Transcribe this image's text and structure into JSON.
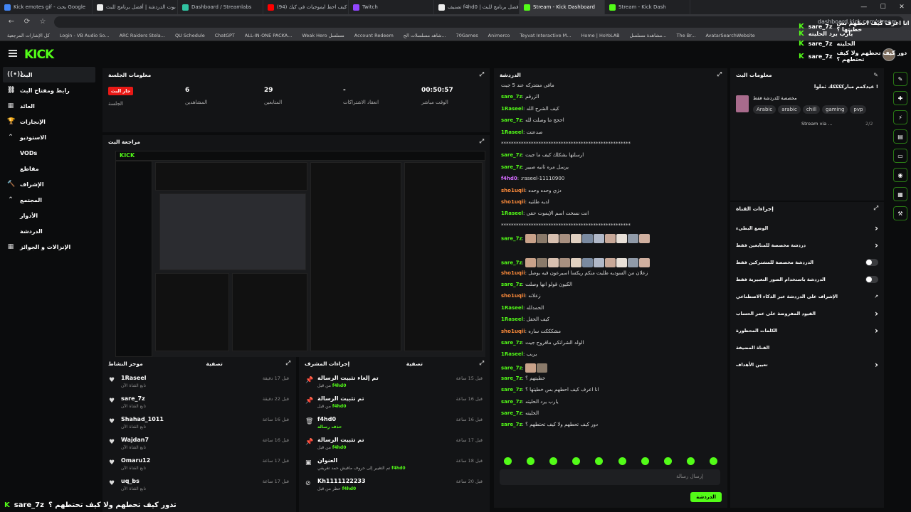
{
  "browser": {
    "tabs": [
      {
        "label": "Kick emotes gif - بحث Google",
        "color": "#4285f4"
      },
      {
        "label": "بوت الدردشة | أفضل برنامج للبث",
        "color": "#eeeeee"
      },
      {
        "label": "Dashboard / Streamlabs",
        "color": "#31c3a2"
      },
      {
        "label": "كيف احط ايموجيات في كيك (94)",
        "color": "#ff0000"
      },
      {
        "label": "Twitch",
        "color": "#9146ff"
      },
      {
        "label": "تصنيف f4hd0 | أفضل برنامج للبث",
        "color": "#eeeeee"
      },
      {
        "label": "Stream - Kick Dashboard",
        "color": "#53fc18"
      },
      {
        "label": "Stream - Kick Dash",
        "color": "#53fc18"
      }
    ],
    "active_tab": 6,
    "address": "dashboard.kick.com/stream",
    "bookmarks": [
      "كل الإشارات المرجعية",
      "Login - VB Audio So...",
      "ARC Raiders Stela...",
      "QU Schedule",
      "ChatGPT",
      "ALL-IN-ONE PACKA...",
      "Weak Hero مسلسل",
      "Account Redeem",
      "شاهد مسلسلات الج...",
      "70Games",
      "Animerco",
      "Teyvat Interactive M...",
      "Home | HoYoLAB",
      "مشاهدة مسلسل...",
      "The Br...",
      "AvatarSearchWebsite"
    ]
  },
  "nav": {
    "logo": "KICK",
    "sidebar": [
      {
        "label": "البث",
        "icon": "((•))",
        "active": true
      },
      {
        "label": "رابط ومفتاح البث",
        "icon": "⛓"
      },
      {
        "label": "العائد",
        "icon": "▦"
      },
      {
        "label": "الإنجازات",
        "icon": "🏆"
      },
      {
        "label": "الاستوديو",
        "icon": "⌃"
      },
      {
        "label": "VODs",
        "sub": true
      },
      {
        "label": "مقاطع",
        "sub": true
      },
      {
        "label": "الإشراف",
        "icon": "🔨"
      },
      {
        "label": "المجتمع",
        "icon": "⌃"
      },
      {
        "label": "الأدوار",
        "sub": true
      },
      {
        "label": "الدردشة",
        "sub": true
      },
      {
        "label": "الإنزالات و الجوائز",
        "icon": "▦"
      }
    ]
  },
  "session": {
    "title": "معلومات الجلسة",
    "live_badge": "جار البث",
    "live_label": "الجلسة",
    "stats": [
      {
        "value": "6",
        "label": "المشاهدين"
      },
      {
        "value": "29",
        "label": "المتابعين"
      },
      {
        "value": "-",
        "label": "انعقاد الاشتراكات"
      },
      {
        "value": "00:50:57",
        "label": "الوقت مباشر"
      }
    ]
  },
  "preview": {
    "title": "مراجعة البث"
  },
  "activity": {
    "title": "موجز النشاط",
    "filter": "تصفية",
    "items": [
      {
        "name": "1Raseel",
        "sub": "تابع القناة الآن",
        "time": "قبل 17 دقيقة"
      },
      {
        "name": "sare_7z",
        "sub": "تابع القناة الآن",
        "time": "قبل 22 دقيقة"
      },
      {
        "name": "Shahad_1011",
        "sub": "تابع القناة الآن",
        "time": "قبل 16 ساعة"
      },
      {
        "name": "Wajdan7",
        "sub": "تابع القناة الآن",
        "time": "قبل 16 ساعة"
      },
      {
        "name": "Omaru12",
        "sub": "تابع القناة الآن",
        "time": "قبل 17 ساعة"
      },
      {
        "name": "uq_bs",
        "sub": "تابع القناة الآن",
        "time": "قبل 17 ساعة"
      }
    ]
  },
  "mod_actions": {
    "title": "إجراءات المشرف",
    "filter": "تصفية",
    "items": [
      {
        "name": "تم إلغاء تثبيت الرسالة",
        "by": "f4hd0",
        "by_prefix": "من قبل",
        "time": "قبل 15 ساعة",
        "icon": "📌"
      },
      {
        "name": "تم تثبيت الرسالة",
        "by": "f4hd0",
        "by_prefix": "من قبل",
        "time": "قبل 16 ساعة",
        "icon": "📌"
      },
      {
        "name": "f4hd0",
        "by": "حذف رسالة",
        "by_prefix": "",
        "time": "قبل 16 ساعة",
        "icon": "🗑"
      },
      {
        "name": "تم تثبيت الرسالة",
        "by": "f4hd0",
        "by_prefix": "من قبل",
        "time": "قبل 17 ساعة",
        "icon": "📌"
      },
      {
        "name": "العنوان",
        "by": "f4hd0",
        "by_prefix": "تم التغيير إلى حروف مافيش حمد تغريقي",
        "time": "قبل 18 ساعة",
        "icon": "▣"
      },
      {
        "name": "Kh1111122233",
        "by": "f4hd0",
        "by_prefix": "حظر من قبل",
        "time": "قبل 20 ساعة",
        "icon": "⊘"
      }
    ]
  },
  "chat": {
    "title": "الدردشة",
    "messages": [
      {
        "user": "",
        "color": "#53fc18",
        "text": "مافي مشتركه عند 5 جيت"
      },
      {
        "user": "sare_7z",
        "color": "#53fc18",
        "text": "الزرقم"
      },
      {
        "user": "1Raseel",
        "color": "#53fc18",
        "text": "كيف الشرح الله"
      },
      {
        "user": "sare_7z",
        "color": "#53fc18",
        "text": "احجج ما وصلت لله"
      },
      {
        "user": "1Raseel",
        "color": "#53fc18",
        "text": "صدعتت"
      },
      {
        "user": "",
        "color": "#ffffff",
        "text": "****************************************************"
      },
      {
        "user": "sare_7z",
        "color": "#53fc18",
        "text": "ارسلتها بشكلك كيف ما جيت"
      },
      {
        "user": "sare_7z",
        "color": "#53fc18",
        "text": "يرسل مره ثانيه صيير"
      },
      {
        "user": "f4hd0",
        "color": "#d46bff",
        "text": ":raseel-11110900"
      },
      {
        "user": "sho1uqii",
        "color": "#ff8c3b",
        "text": "دزي وحده وحده"
      },
      {
        "user": "sho1uqii",
        "color": "#ff8c3b",
        "text": "لديه طلتيه"
      },
      {
        "user": "1Raseel",
        "color": "#53fc18",
        "text": "انت نسخت اسم الإيموت حقي"
      },
      {
        "user": "",
        "color": "#ffffff",
        "text": "****************************************************"
      },
      {
        "user": "sare_7z",
        "color": "#53fc18",
        "emotes": 11
      },
      {
        "user": "",
        "color": "#53fc18",
        "emotes": 0
      },
      {
        "user": "sare_7z",
        "color": "#53fc18",
        "emotes": 11
      },
      {
        "user": "sho1uqii",
        "color": "#ff8c3b",
        "text": "زعلان من السوديه طليت منكم ريكسا اسيرعون فيه يوصل"
      },
      {
        "user": "sare_7z",
        "color": "#53fc18",
        "text": "الكيون قولو انها وصلت"
      },
      {
        "user": "sho1uqii",
        "color": "#ff8c3b",
        "text": "زعلانه"
      },
      {
        "user": "1Raseel",
        "color": "#53fc18",
        "text": "الحمدلله"
      },
      {
        "user": "1Raseel",
        "color": "#53fc18",
        "text": "كيف الحقل"
      },
      {
        "user": "sho1uqii",
        "color": "#ff8c3b",
        "text": "مشكككت ساره"
      },
      {
        "user": "sare_7z",
        "color": "#53fc18",
        "text": "الولد الشرانكي ماقروح جيت"
      },
      {
        "user": "1Raseel",
        "color": "#53fc18",
        "text": "يربب"
      },
      {
        "user": "sare_7z",
        "color": "#53fc18",
        "emotes": 2
      },
      {
        "user": "sare_7z",
        "color": "#53fc18",
        "text": "خطيتهم ؟"
      },
      {
        "user": "sare_7z",
        "color": "#53fc18",
        "text": "انا اعرف كيف احطهم بس خطيتها ؟"
      },
      {
        "user": "sare_7z",
        "color": "#53fc18",
        "text": "يارب يرد الحليته"
      },
      {
        "user": "sare_7z",
        "color": "#53fc18",
        "text": "الحليته"
      },
      {
        "user": "sare_7z",
        "color": "#53fc18",
        "text": "دور كيف تحطهم ولا كيف تحتطهم ؟"
      }
    ],
    "input_placeholder": "إرسال رسالة",
    "send_label": "الدردشة"
  },
  "stream_info": {
    "title": "معلومات البث",
    "stream_title": "عيدكمم مبارككككك ثملوا !",
    "category": "مخصصة للدردشة فقط",
    "tags": [
      "Arabic",
      "arabic",
      "chill",
      "gaming",
      "pvp"
    ],
    "page": "2/2",
    "stream_via": "Stream via ..."
  },
  "channel_actions": {
    "title": "إجراءات القناة",
    "rows": [
      {
        "label": "الوضع البطيء",
        "control": "chevron"
      },
      {
        "label": "دردشة مخصصة للمتابعين فقط",
        "control": "chevron"
      },
      {
        "label": "الدردشة مخصصة للمشتركين فقط",
        "control": "toggle"
      },
      {
        "label": "الدردشة باستخدام الصور التعبيرية فقط",
        "control": "toggle"
      },
      {
        "label": "الإشراف على الدردشة عبر الذكاء الاصطناعي",
        "control": "link"
      },
      {
        "label": "القيود المفروضة على عمر الحساب",
        "control": "chevron"
      },
      {
        "label": "الكلمات المحظورة",
        "control": "chevron"
      },
      {
        "label": "القناة المضيفة",
        "control": "none"
      },
      {
        "label": "تعيين الأهداف",
        "control": "chevron"
      }
    ]
  },
  "overlay": {
    "top_messages": [
      {
        "user": "sare_7z",
        "text": "انا اعرف كيف احطهم بس خطيتها ؟"
      },
      {
        "user": "",
        "text": "يارب يرد الحليته"
      },
      {
        "user": "sare_7z",
        "text": "الحليته"
      },
      {
        "user": "sare_7z",
        "text": "دور كيف تحطهم ولا كيف تحتطهم ؟"
      }
    ],
    "bottom_message": {
      "user": "sare_7z",
      "text": "تدور كيف تحطهم ولا كيف تحتطهم ؟"
    }
  }
}
